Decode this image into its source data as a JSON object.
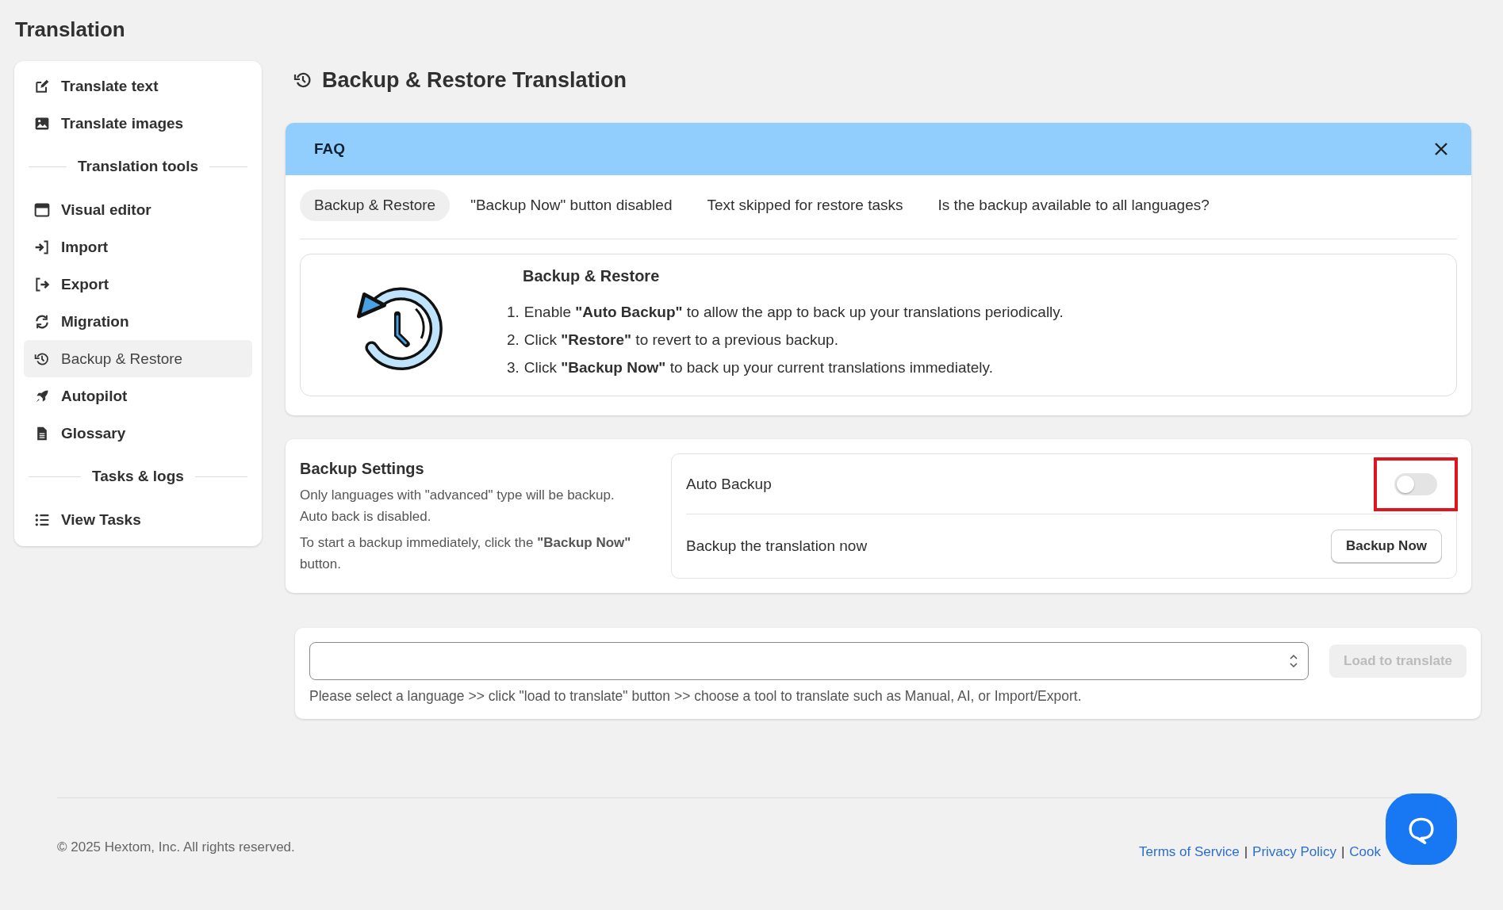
{
  "page": {
    "title": "Translation"
  },
  "sidebar": {
    "items": [
      {
        "kind": "item",
        "label": "Translate text",
        "selected": false
      },
      {
        "kind": "item",
        "label": "Translate images",
        "selected": false
      },
      {
        "kind": "heading",
        "label": "Translation tools"
      },
      {
        "kind": "item",
        "label": "Visual editor",
        "selected": false
      },
      {
        "kind": "item",
        "label": "Import",
        "selected": false
      },
      {
        "kind": "item",
        "label": "Export",
        "selected": false
      },
      {
        "kind": "item",
        "label": "Migration",
        "selected": false
      },
      {
        "kind": "item",
        "label": "Backup & Restore",
        "selected": true
      },
      {
        "kind": "item",
        "label": "Autopilot",
        "selected": false
      },
      {
        "kind": "item",
        "label": "Glossary",
        "selected": false
      },
      {
        "kind": "heading",
        "label": "Tasks & logs"
      },
      {
        "kind": "item",
        "label": "View Tasks",
        "selected": false
      }
    ]
  },
  "header": {
    "title": "Backup & Restore Translation"
  },
  "faq": {
    "title": "FAQ",
    "tabs": [
      {
        "label": "Backup & Restore",
        "selected": true
      },
      {
        "label": "\"Backup Now\" button disabled",
        "selected": false
      },
      {
        "label": "Text skipped for restore tasks",
        "selected": false
      },
      {
        "label": "Is the backup available to all languages?",
        "selected": false
      }
    ],
    "content": {
      "title": "Backup & Restore",
      "steps": [
        {
          "number": "1.",
          "text": "Enable **\"Auto Backup\"** to allow the app to back up your translations periodically."
        },
        {
          "number": "2.",
          "text": "Click **\"Restore\"** to revert to a previous backup."
        },
        {
          "number": "3.",
          "text": "Click **\"Backup Now\"** to back up your current translations immediately."
        }
      ]
    }
  },
  "backup_settings": {
    "title": "Backup Settings",
    "description": [
      "Only languages with \"advanced\" type will be backup.",
      "Auto back is disabled."
    ],
    "note": "To start a backup immediately, click the **\"Backup Now\"** button.",
    "rows": [
      {
        "kind": "toggle",
        "label": "Auto Backup",
        "on": false,
        "highlighted": true
      },
      {
        "kind": "button",
        "label": "Backup the translation now",
        "button": "Backup Now"
      }
    ]
  },
  "language": {
    "button": {
      "label": "Load to translate",
      "disabled": true
    },
    "hint": "Please select a language >> click \"load to translate\" button >> choose a tool to translate such as Manual, AI, or Import/Export."
  },
  "footer": {
    "copyright": "© 2025 Hextom, Inc. All rights reserved.",
    "links": [
      "Terms of Service",
      "Privacy Policy",
      "Cook"
    ],
    "separator": "|"
  }
}
